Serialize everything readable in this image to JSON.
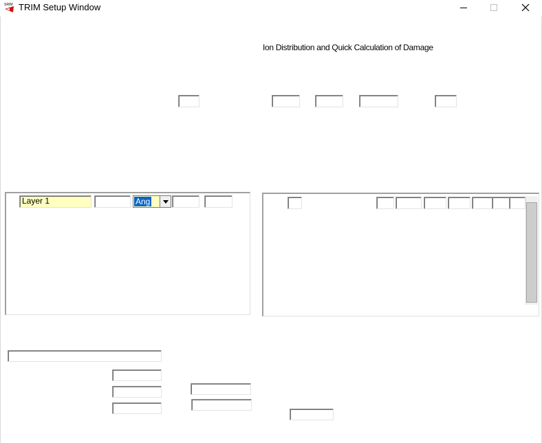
{
  "window": {
    "title": "TRIM Setup Window",
    "icon": "srim-logo-icon"
  },
  "controls": {
    "minimize_icon": "minimize-icon",
    "maximize_icon": "maximize-icon",
    "close_icon": "close-icon"
  },
  "calc_type": {
    "selected_label": "Ion Distribution and Quick Calculation of Damage"
  },
  "target_layers": {
    "rows": [
      {
        "name": "Layer 1",
        "width": "",
        "unit": "Ang",
        "density": "",
        "compound_corr": ""
      }
    ]
  },
  "colors": {
    "field_highlight": "#ffffc0",
    "selection": "#0a64c8",
    "border": "#9a9a9a"
  }
}
